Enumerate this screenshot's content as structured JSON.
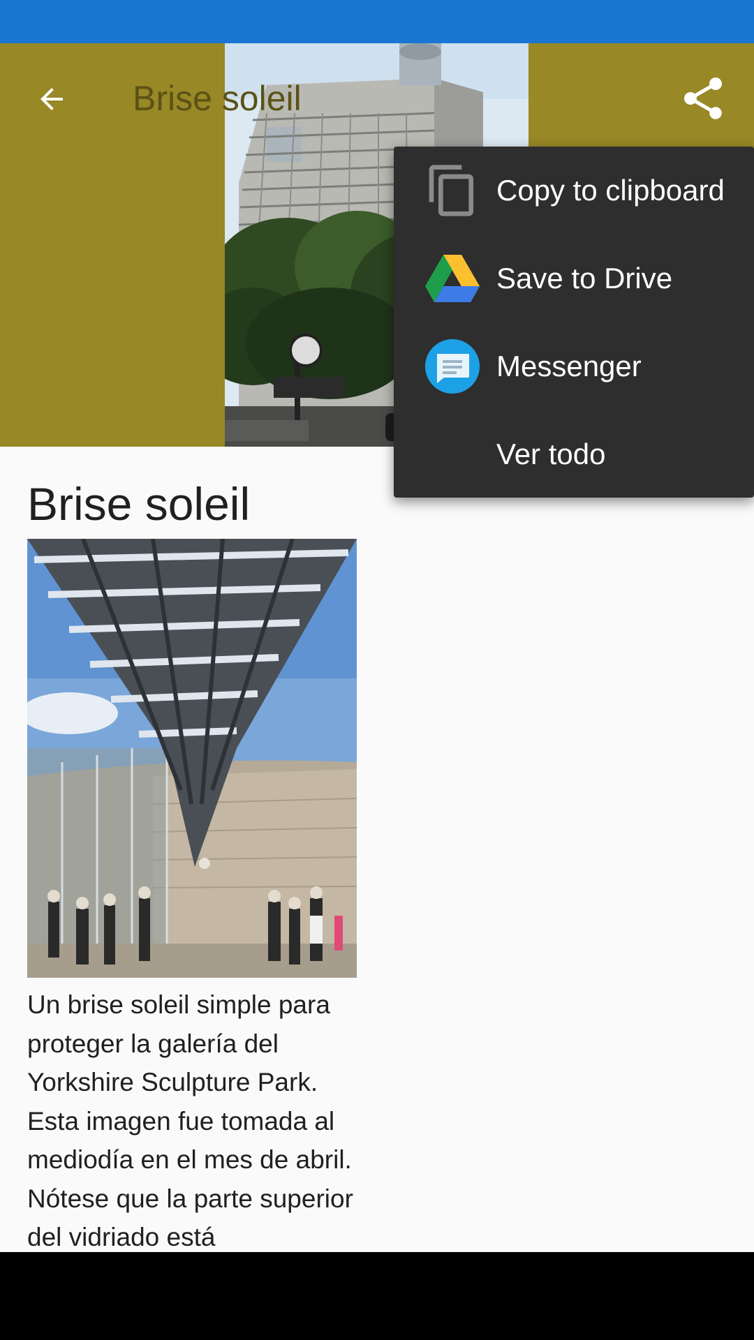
{
  "toolbar": {
    "title": "Brise soleil",
    "back_icon": "arrow-back-icon",
    "share_icon": "share-icon"
  },
  "article": {
    "title": "Brise soleil",
    "body": "Un brise soleil simple para proteger la galería del Yorkshire Sculpture Park. Esta imagen fue tomada al mediodía en el mes de abril. Nótese que la parte superior del vidriado está"
  },
  "share_menu": {
    "items": [
      {
        "label": "Copy to clipboard",
        "icon": "copy-icon"
      },
      {
        "label": "Save to Drive",
        "icon": "google-drive-icon"
      },
      {
        "label": "Messenger",
        "icon": "messenger-icon"
      },
      {
        "label": "Ver todo",
        "icon": ""
      }
    ]
  },
  "colors": {
    "status_bar": "#1976d2",
    "header_background": "#988826",
    "menu_background": "#2e2e2e",
    "page_background": "#fafafa"
  }
}
